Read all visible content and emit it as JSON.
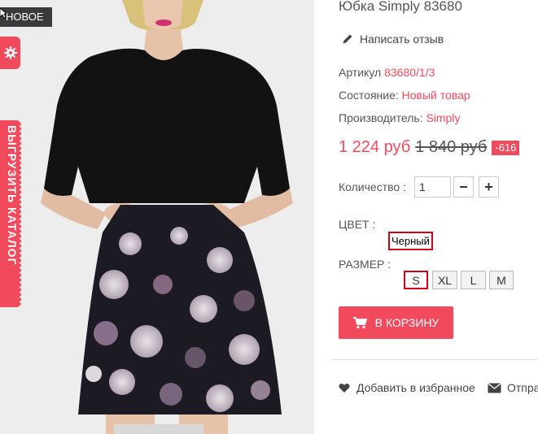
{
  "product": {
    "title": "Юбка Simply 83680",
    "badge": "НОВОЕ"
  },
  "side_tab": {
    "label": "ВЫГРУЗИТЬ КАТАЛОГ"
  },
  "actions": {
    "write_review": "Написать отзыв",
    "add_to_wishlist": "Добавить в избранное",
    "send": "Отпра"
  },
  "details": {
    "sku_label": "Артикул",
    "sku_value": "83680/1/3",
    "condition_label": "Состояние:",
    "condition_value": "Новый товар",
    "manufacturer_label": "Производитель:",
    "manufacturer_value": "Simply"
  },
  "price": {
    "current": "1 224 руб",
    "old": "1 840 руб",
    "discount": "-616"
  },
  "quantity": {
    "label": "Количество :",
    "value": "1",
    "minus": "−",
    "plus": "+"
  },
  "color": {
    "label": "ЦВЕТ :",
    "selected": "Черный"
  },
  "size": {
    "label": "РАЗМЕР :",
    "options": [
      "S",
      "XL",
      "L",
      "M"
    ],
    "selected": "S"
  },
  "cart": {
    "label": "В КОРЗИНУ"
  },
  "colors": {
    "accent": "#f04a5c",
    "selected_border": "#d0021b",
    "badge_bg": "#3a3a3a"
  },
  "icons": {
    "badge_cursor": "cursor-arrow-icon",
    "settings": "gear-icon",
    "review": "pencil-icon",
    "cart": "cart-icon",
    "wishlist": "heart-icon",
    "send": "envelope-icon"
  }
}
